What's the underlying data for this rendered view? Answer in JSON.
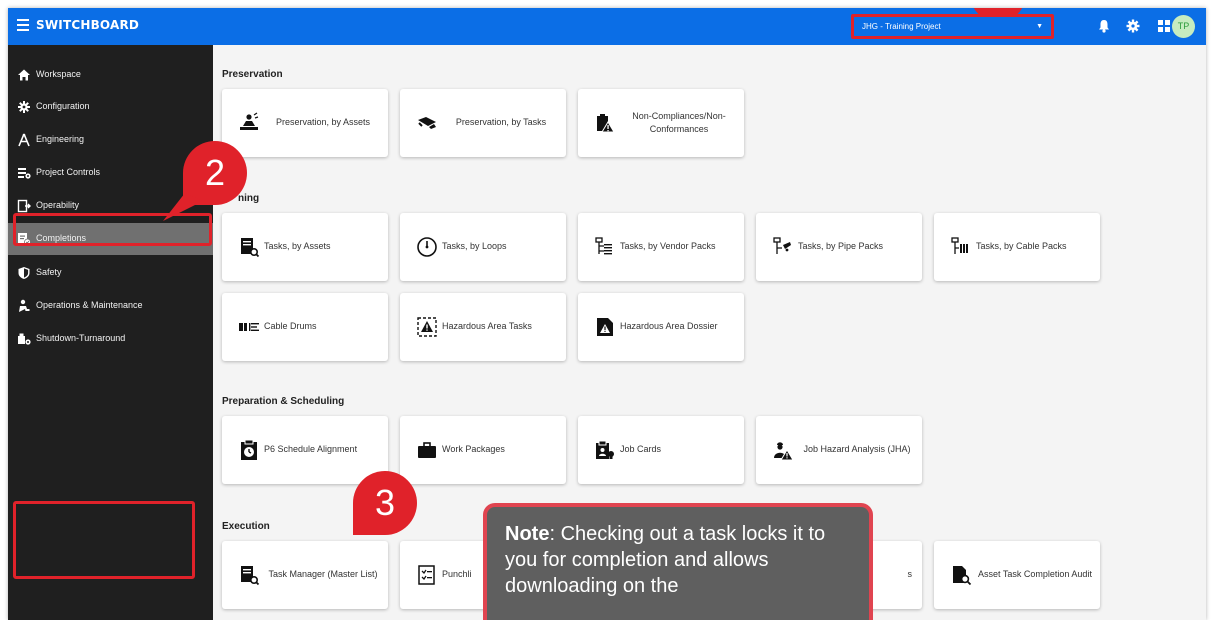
{
  "topbar": {
    "app_title": "SWITCHBOARD",
    "project_select": "JHG - Training Project",
    "avatar_initials": "TP",
    "accent_color": "#0b6ee6"
  },
  "sidebar": {
    "items": [
      {
        "label": "Workspace",
        "icon": "home-icon"
      },
      {
        "label": "Configuration",
        "icon": "gear-icon"
      },
      {
        "label": "Engineering",
        "icon": "compass-icon"
      },
      {
        "label": "Project Controls",
        "icon": "controls-icon"
      },
      {
        "label": "Operability",
        "icon": "operability-icon"
      },
      {
        "label": "Completions",
        "icon": "completions-icon",
        "active": true
      },
      {
        "label": "Safety",
        "icon": "shield-icon"
      },
      {
        "label": "Operations & Maintenance",
        "icon": "maintenance-icon"
      },
      {
        "label": "Shutdown-Turnaround",
        "icon": "turnaround-icon"
      }
    ]
  },
  "sections": {
    "preservation": {
      "title": "Preservation",
      "cards": [
        "Preservation, by Assets",
        "Preservation, by Tasks",
        "Non-Compliances/Non-Conformances"
      ]
    },
    "testing": {
      "title": "ning",
      "cards": [
        "Tasks, by Assets",
        "Tasks, by Loops",
        "Tasks, by Vendor Packs",
        "Tasks, by Pipe Packs",
        "Tasks, by Cable Packs",
        "Cable Drums",
        "Hazardous Area Tasks",
        "Hazardous Area Dossier"
      ]
    },
    "preparation": {
      "title": "Preparation & Scheduling",
      "cards": [
        "P6 Schedule Alignment",
        "Work Packages",
        "Job Cards",
        "Job Hazard Analysis (JHA)"
      ]
    },
    "execution": {
      "title": "Execution",
      "cards": [
        "Task Manager (Master List)",
        "Punchli",
        "s",
        "Asset Task Completion Audit"
      ]
    }
  },
  "callouts": {
    "badge_2": "2",
    "badge_3": "3",
    "note_label": "Note",
    "note_text": ": Checking out a task locks it to you for completion and allows downloading on the"
  }
}
